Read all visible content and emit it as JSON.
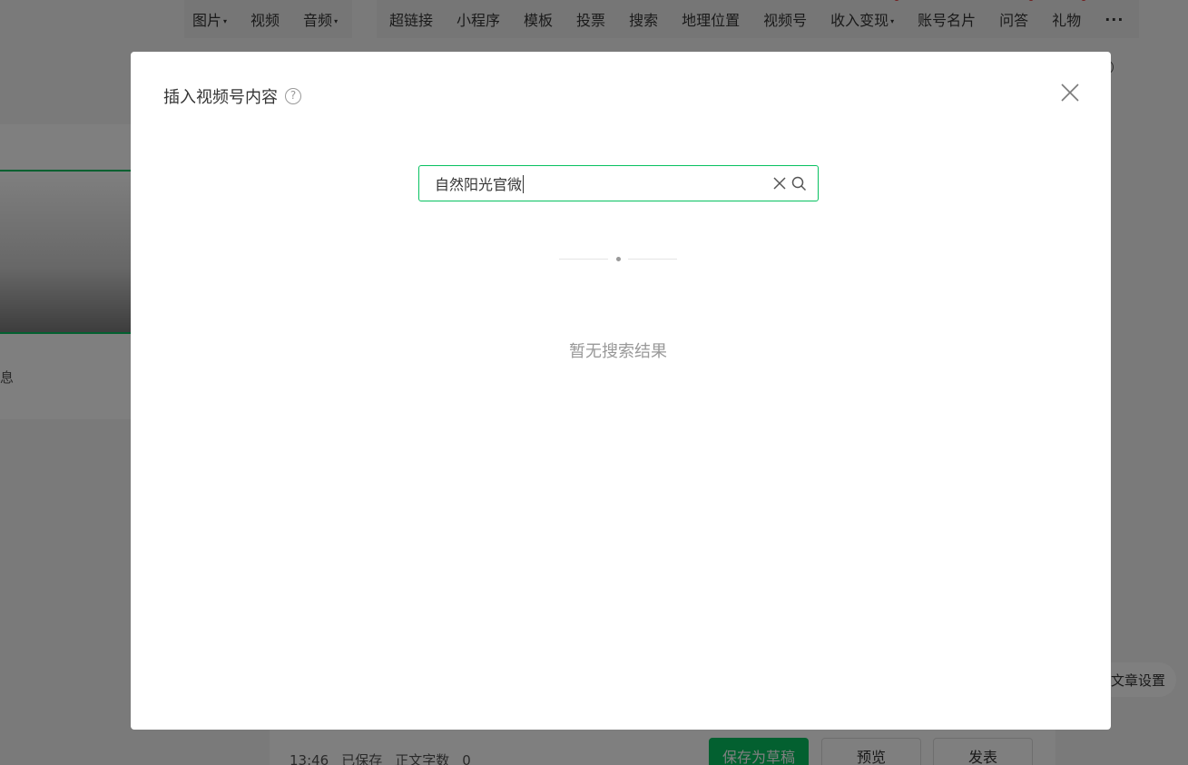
{
  "toolbar": {
    "group1": [
      {
        "label": "图片",
        "has_caret": true
      },
      {
        "label": "视频",
        "has_caret": false
      },
      {
        "label": "音频",
        "has_caret": true
      }
    ],
    "group2": [
      {
        "label": "超链接"
      },
      {
        "label": "小程序"
      },
      {
        "label": "模板"
      },
      {
        "label": "投票"
      },
      {
        "label": "搜索"
      },
      {
        "label": "地理位置"
      },
      {
        "label": "视频号"
      },
      {
        "label": "收入变现",
        "has_caret": true,
        "badge": true
      },
      {
        "label": "账号名片"
      },
      {
        "label": "问答",
        "badge": true
      },
      {
        "label": "礼物",
        "badge": true
      }
    ],
    "more_label": "···"
  },
  "sidebar": {
    "partial_text": "息"
  },
  "right_panel": {
    "article_settings_label": "文章设置"
  },
  "footer": {
    "time": "13:46",
    "saved_label": "已保存",
    "word_count_label": "正文字数",
    "word_count": "0",
    "save_draft_label": "保存为草稿",
    "preview_label": "预览",
    "publish_label": "发表"
  },
  "dialog": {
    "title": "插入视频号内容",
    "help_glyph": "?",
    "search": {
      "value": "自然阳光官微",
      "placeholder": ""
    },
    "empty_message": "暂无搜索结果"
  },
  "colors": {
    "accent": "#07c160",
    "badge": "#e5393b",
    "overlay": "rgba(0,0,0,0.5)"
  }
}
